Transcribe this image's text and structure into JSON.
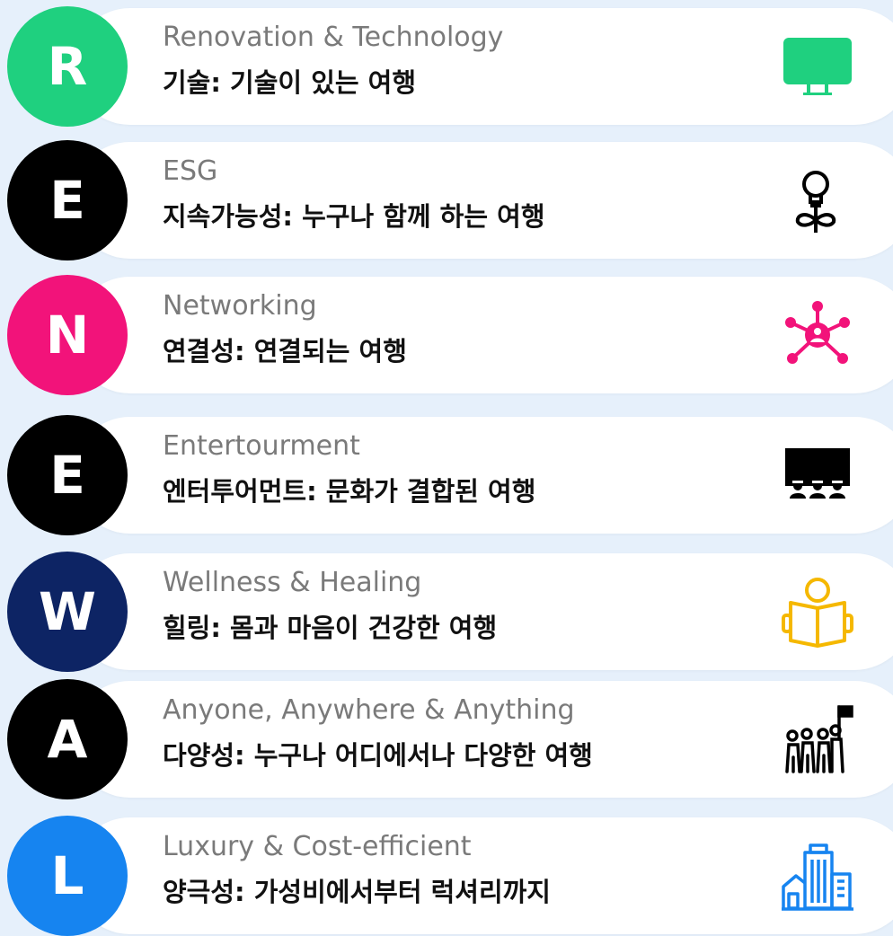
{
  "colors": {
    "background": "#e6f0fb",
    "card": "#ffffff",
    "english_text": "#7a7a7a",
    "korean_text": "#111111"
  },
  "items": [
    {
      "letter": "R",
      "circle_color": "#1fd07f",
      "english": "Renovation & Technology",
      "korean": "기술: 기술이 있는 여행",
      "icon": "monitor-icon",
      "icon_color": "#1fd07f"
    },
    {
      "letter": "E",
      "circle_color": "#000000",
      "english": "ESG",
      "korean": "지속가능성: 누구나 함께 하는 여행",
      "icon": "lightbulb-plant-icon",
      "icon_color": "#000000"
    },
    {
      "letter": "N",
      "circle_color": "#f2137a",
      "english": "Networking",
      "korean": "연결성: 연결되는 여행",
      "icon": "network-icon",
      "icon_color": "#f2137a"
    },
    {
      "letter": "E",
      "circle_color": "#000000",
      "english": "Entertourment",
      "korean": "엔터투어먼트: 문화가 결합된 여행",
      "icon": "theater-audience-icon",
      "icon_color": "#000000"
    },
    {
      "letter": "W",
      "circle_color": "#0d2464",
      "english": "Wellness & Healing",
      "korean": "힐링: 몸과 마음이 건강한 여행",
      "icon": "person-reading-icon",
      "icon_color": "#f5b800"
    },
    {
      "letter": "A",
      "circle_color": "#000000",
      "english": "Anyone, Anywhere & Anything",
      "korean": "다양성: 누구나 어디에서나 다양한 여행",
      "icon": "crowd-flag-icon",
      "icon_color": "#000000"
    },
    {
      "letter": "L",
      "circle_color": "#1684f0",
      "english": "Luxury & Cost-efficient",
      "korean": "양극성: 가성비에서부터 럭셔리까지",
      "icon": "buildings-icon",
      "icon_color": "#1684f0"
    }
  ]
}
